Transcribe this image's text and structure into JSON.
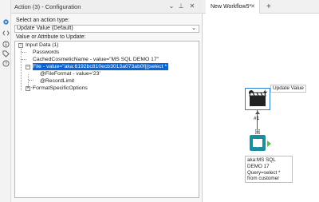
{
  "panel": {
    "title": "Action (3) - Configuration",
    "action_type_label": "Select an action type:",
    "action_type_value": "Update Value (Default)",
    "value_label": "Value or Attribute to Update:"
  },
  "tree": {
    "items": [
      {
        "label": "Input Data (1)",
        "toggle": "−"
      },
      {
        "label": "Passwords"
      },
      {
        "label": "CachedCosmeticName - value=\"MS SQL DEMO 17\""
      },
      {
        "label": "File - value=\"aka:6192bc810ecb3013a073ab0f|||select *",
        "toggle": "−"
      },
      {
        "label": "@FileFormat - value='23'"
      },
      {
        "label": "@RecordLimit"
      },
      {
        "label": "FormatSpecificOptions",
        "toggle": "+"
      }
    ]
  },
  "canvas": {
    "tab_label": "New Workflow5*",
    "tab_close": "✕",
    "tab_add": "+",
    "tool_label": "Update Value",
    "connection_label": "#1",
    "input_description": [
      "aka:MS SQL",
      "DEMO 17",
      "Query=select *",
      "from customer"
    ]
  },
  "icons": {
    "rail": [
      "gear-icon",
      "code-icon",
      "info-icon",
      "tag-icon",
      "help-icon"
    ]
  },
  "colors": {
    "selection": "#0a64d6",
    "tool_border": "#2d7fd3",
    "input_tool": "#1b8fa0"
  }
}
